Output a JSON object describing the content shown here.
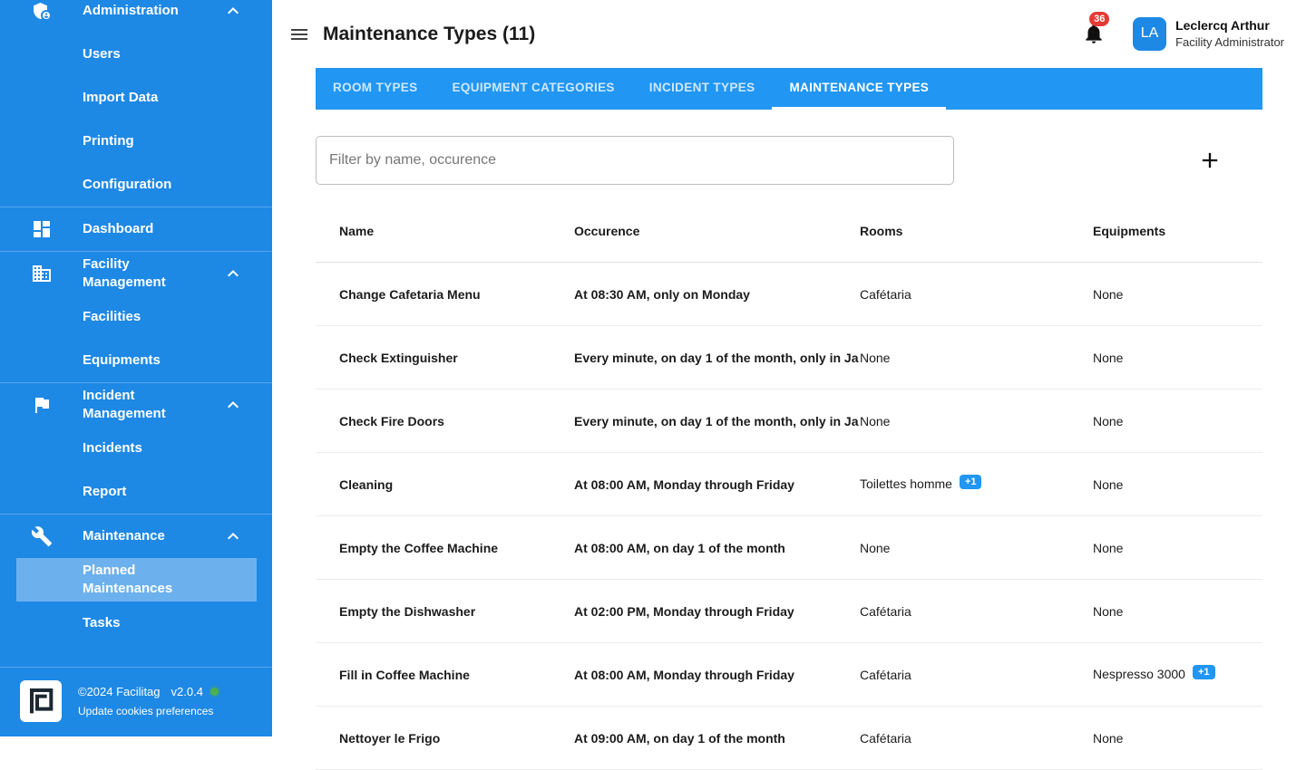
{
  "colors": {
    "accent": "#2196F3",
    "sidebar": "#1E88E5",
    "selected_item": "rgba(255,255,255,0.35)",
    "badge_red": "#E53935",
    "status_green": "#4CAF50"
  },
  "sidebar": {
    "items": [
      {
        "label": "Administration"
      },
      {
        "label": "Users"
      },
      {
        "label": "Import Data"
      },
      {
        "label": "Printing"
      },
      {
        "label": "Configuration"
      },
      {
        "label": "Dashboard"
      },
      {
        "label": "Facility Management"
      },
      {
        "label": "Facilities"
      },
      {
        "label": "Equipments"
      },
      {
        "label": "Incident Management"
      },
      {
        "label": "Incidents"
      },
      {
        "label": "Report"
      },
      {
        "label": "Maintenance"
      },
      {
        "label": "Planned Maintenances"
      },
      {
        "label": "Tasks"
      }
    ],
    "footer": {
      "copyright": "©2024 Facilitag",
      "version": "v2.0.4",
      "cookies": "Update cookies preferences"
    }
  },
  "header": {
    "title": "Maintenance Types (11)",
    "notifications_count": "36",
    "avatar_initials": "LA",
    "user_name": "Leclercq Arthur",
    "user_role": "Facility Administrator"
  },
  "tabs": {
    "items": [
      {
        "label": "ROOM TYPES"
      },
      {
        "label": "EQUIPMENT CATEGORIES"
      },
      {
        "label": "INCIDENT TYPES"
      },
      {
        "label": "MAINTENANCE TYPES"
      }
    ]
  },
  "filter": {
    "placeholder": "Filter by name, occurence"
  },
  "table": {
    "columns": [
      "Name",
      "Occurence",
      "Rooms",
      "Equipments"
    ],
    "rows": [
      {
        "name": "Change Cafetaria Menu",
        "occurrence": "At 08:30 AM, only on Monday",
        "rooms": "Cafétaria",
        "equipments": "None"
      },
      {
        "name": "Check Extinguisher",
        "occurrence": "Every minute, on day 1 of the month, only in Ja",
        "rooms": "None",
        "equipments": "None"
      },
      {
        "name": "Check Fire Doors",
        "occurrence": "Every minute, on day 1 of the month, only in Ja",
        "rooms": "None",
        "equipments": "None"
      },
      {
        "name": "Cleaning",
        "occurrence": "At 08:00 AM, Monday through Friday",
        "rooms": "Toilettes homme",
        "rooms_badge": "+1",
        "equipments": "None"
      },
      {
        "name": "Empty the Coffee Machine",
        "occurrence": "At 08:00 AM, on day 1 of the month",
        "rooms": "None",
        "equipments": "None"
      },
      {
        "name": "Empty the Dishwasher",
        "occurrence": "At 02:00 PM, Monday through Friday",
        "rooms": "Cafétaria",
        "equipments": "None"
      },
      {
        "name": "Fill in Coffee Machine",
        "occurrence": "At 08:00 AM, Monday through Friday",
        "rooms": "Cafétaria",
        "equipments": "Nespresso 3000",
        "equipments_badge": "+1"
      },
      {
        "name": "Nettoyer le Frigo",
        "occurrence": "At 09:00 AM, on day 1 of the month",
        "rooms": "Cafétaria",
        "equipments": "None"
      }
    ]
  }
}
